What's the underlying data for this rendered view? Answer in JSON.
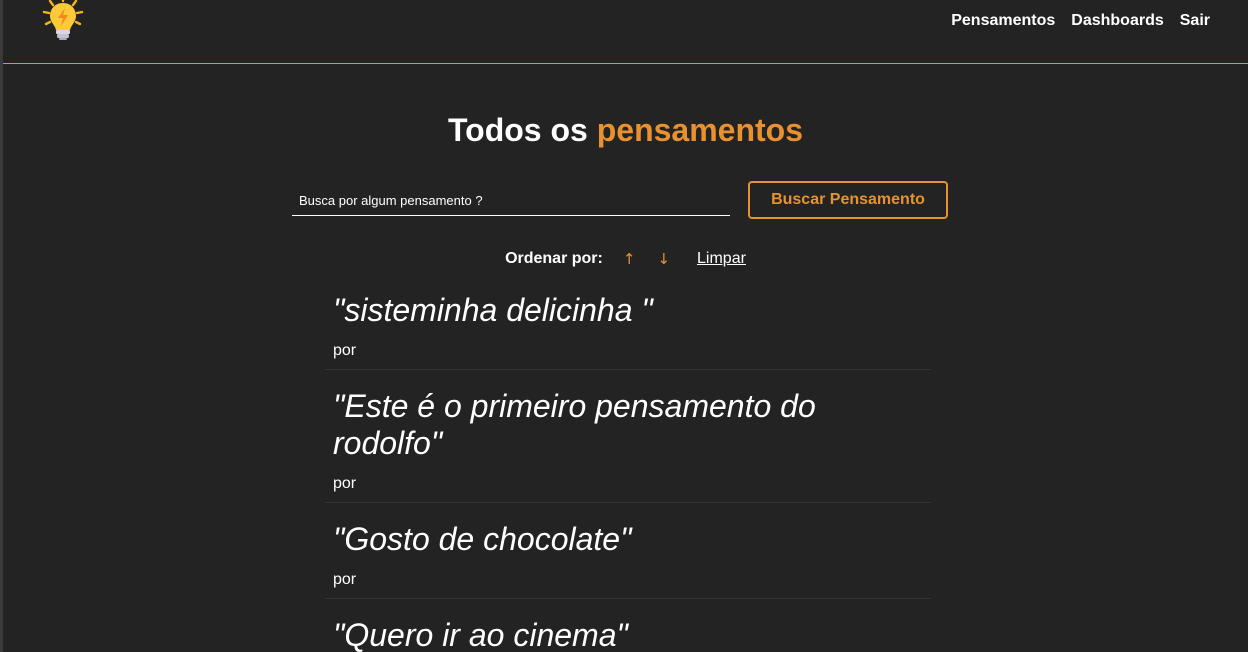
{
  "navbar": {
    "logo_icon": "lightbulb-icon",
    "links": [
      {
        "label": "Pensamentos"
      },
      {
        "label": "Dashboards"
      },
      {
        "label": "Sair"
      }
    ]
  },
  "page": {
    "title_prefix": "Todos os ",
    "title_accent": "pensamentos",
    "accent_color": "#e8922f",
    "background_color": "#232323"
  },
  "search": {
    "placeholder": "Busca por algum pensamento ?",
    "button_label": "Buscar Pensamento"
  },
  "order": {
    "label": "Ordenar por:",
    "asc_icon": "arrow-up-icon",
    "asc_symbol": "↑",
    "desc_icon": "arrow-down-icon",
    "desc_symbol": "↓",
    "clear_label": "Limpar"
  },
  "thoughts": [
    {
      "text": "\"sisteminha delicinha \"",
      "author": "por"
    },
    {
      "text": "\"Este é o primeiro pensamento do rodolfo\"",
      "author": "por"
    },
    {
      "text": "\"Gosto de chocolate\"",
      "author": "por"
    },
    {
      "text": "\"Quero ir ao cinema\"",
      "author": ""
    }
  ]
}
